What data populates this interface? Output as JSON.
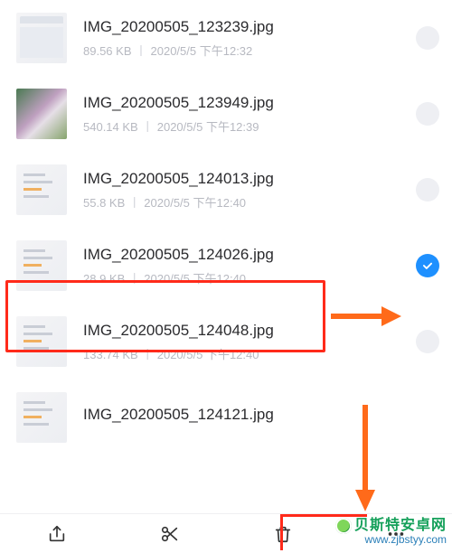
{
  "files": [
    {
      "name": "IMG_20200505_123239.jpg",
      "size": "89.56 KB",
      "date": "2020/5/5 下午12:32",
      "selected": false,
      "thumb": "ui"
    },
    {
      "name": "IMG_20200505_123949.jpg",
      "size": "540.14 KB",
      "date": "2020/5/5 下午12:39",
      "selected": false,
      "thumb": "photo"
    },
    {
      "name": "IMG_20200505_124013.jpg",
      "size": "55.8 KB",
      "date": "2020/5/5 下午12:40",
      "selected": false,
      "thumb": "doc"
    },
    {
      "name": "IMG_20200505_124026.jpg",
      "size": "28.9 KB",
      "date": "2020/5/5 下午12:40",
      "selected": true,
      "thumb": "doc"
    },
    {
      "name": "IMG_20200505_124048.jpg",
      "size": "133.74 KB",
      "date": "2020/5/5 下午12:40",
      "selected": false,
      "thumb": "doc"
    },
    {
      "name": "IMG_20200505_124121.jpg",
      "size": "",
      "date": "",
      "selected": false,
      "thumb": "doc"
    }
  ],
  "highlight_index": 3,
  "meta_separator": "丨",
  "toolbar": {
    "share": "share-icon",
    "cut": "scissors-icon",
    "delete": "trash-icon",
    "more": "more-icon"
  },
  "watermark": {
    "brand": "贝斯特安卓网",
    "url": "www.zjbstyy.com"
  },
  "annotation_color": "#ff6a1a"
}
